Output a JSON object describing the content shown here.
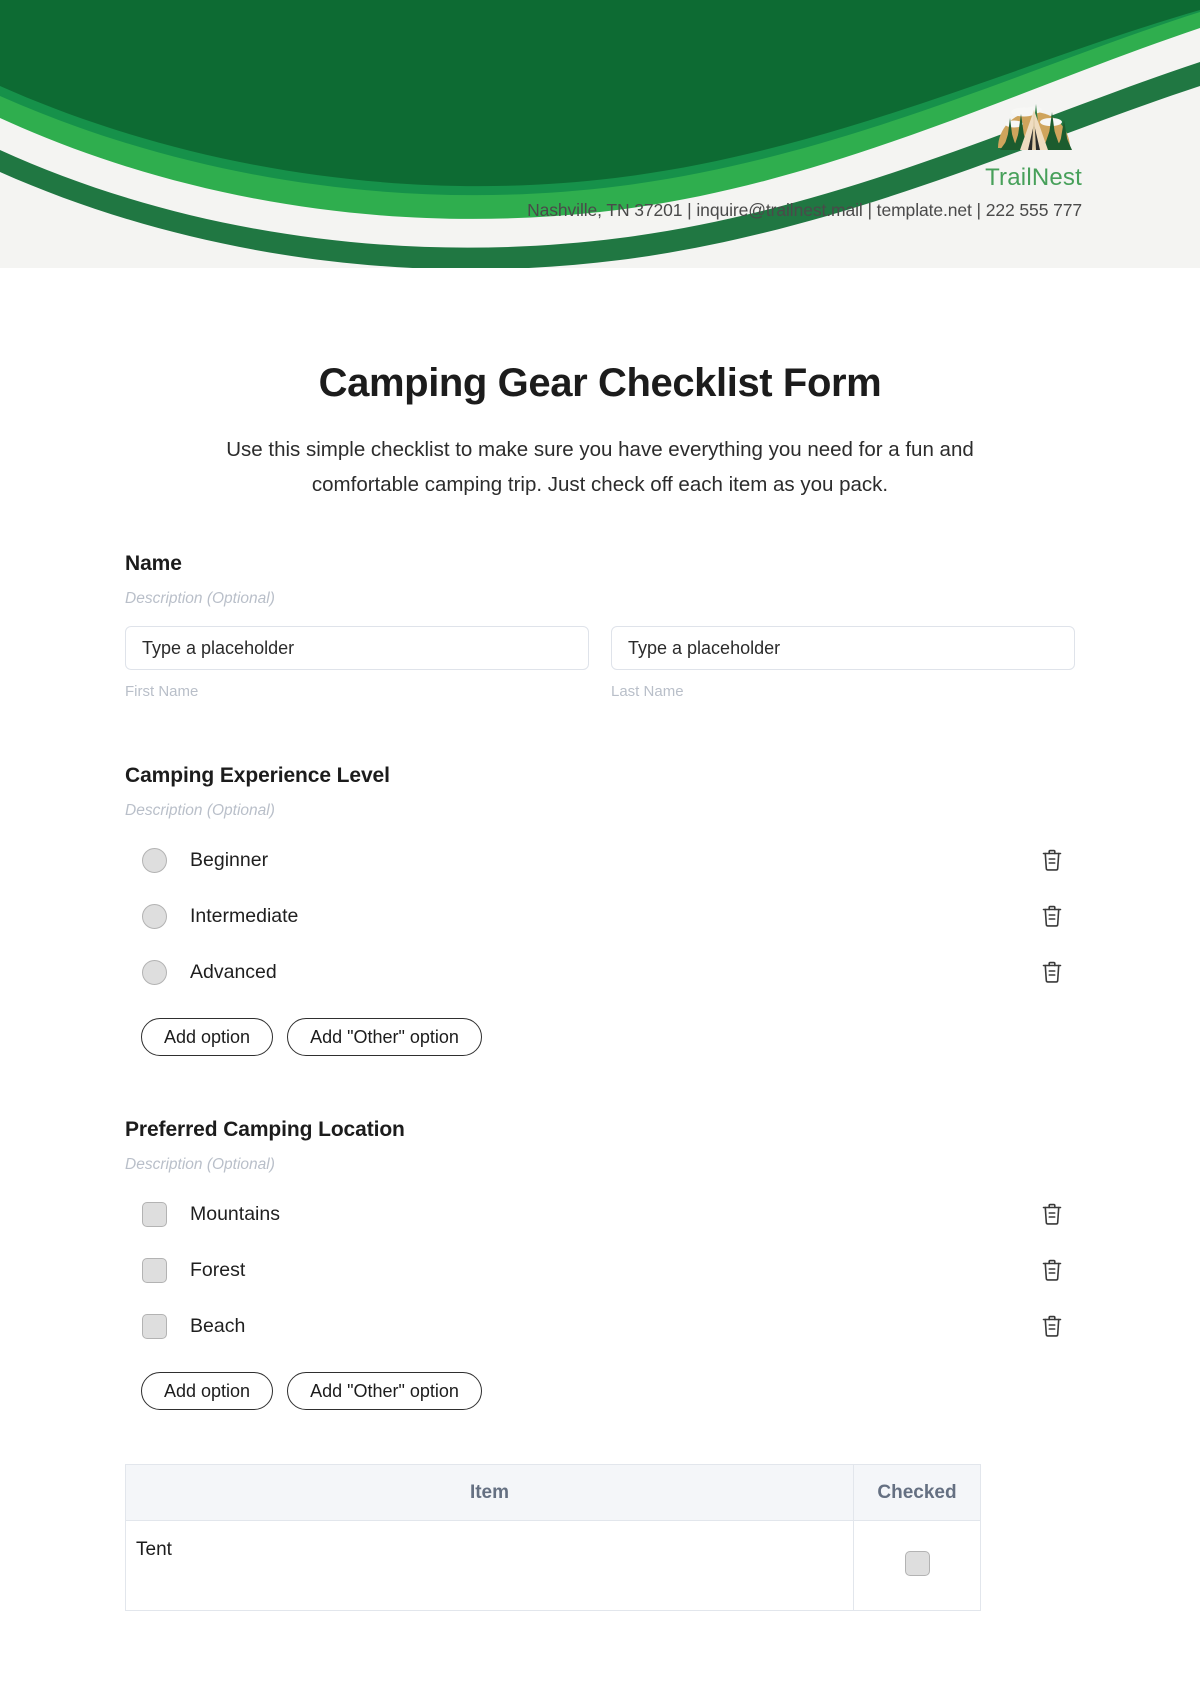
{
  "brand": {
    "name": "TrailNest",
    "contact": "Nashville, TN 37201 | inquire@trailnest.mail | template.net | 222 555 777",
    "logo_icon": "camping-tent-forest-logo",
    "colors": {
      "dark_green": "#0d6b33",
      "mid_green": "#16914a",
      "light_green": "#2fae4e",
      "brand_text_green": "#47a05a",
      "header_bg": "#f4f4f2",
      "logo_sun": "#cfa css",
      "logo_sun_hex": "#cfa45c",
      "logo_tree": "#1c5c2e",
      "logo_tent": "#efdcc0"
    }
  },
  "form": {
    "title": "Camping Gear Checklist Form",
    "description": "Use this simple checklist to make sure you have everything you need for a fun and comfortable camping trip. Just check off each item as you pack."
  },
  "name_field": {
    "label": "Name",
    "description": "Description (Optional)",
    "first": {
      "placeholder": "Type a placeholder",
      "value": "",
      "sub_label": "First Name"
    },
    "last": {
      "placeholder": "Type a placeholder",
      "value": "",
      "sub_label": "Last Name"
    }
  },
  "experience_field": {
    "label": "Camping Experience Level",
    "description": "Description (Optional)",
    "options": [
      {
        "label": "Beginner",
        "selected": false
      },
      {
        "label": "Intermediate",
        "selected": false
      },
      {
        "label": "Advanced",
        "selected": false
      }
    ],
    "add_option_label": "Add option",
    "add_other_label": "Add \"Other\" option",
    "delete_icon": "trash-icon"
  },
  "location_field": {
    "label": "Preferred Camping Location",
    "description": "Description (Optional)",
    "options": [
      {
        "label": "Mountains",
        "checked": false
      },
      {
        "label": "Forest",
        "checked": false
      },
      {
        "label": "Beach",
        "checked": false
      }
    ],
    "add_option_label": "Add option",
    "add_other_label": "Add \"Other\" option",
    "delete_icon": "trash-icon"
  },
  "gear_table": {
    "columns": [
      "Item",
      "Checked"
    ],
    "rows": [
      {
        "item": "Tent",
        "checked": false
      }
    ]
  }
}
